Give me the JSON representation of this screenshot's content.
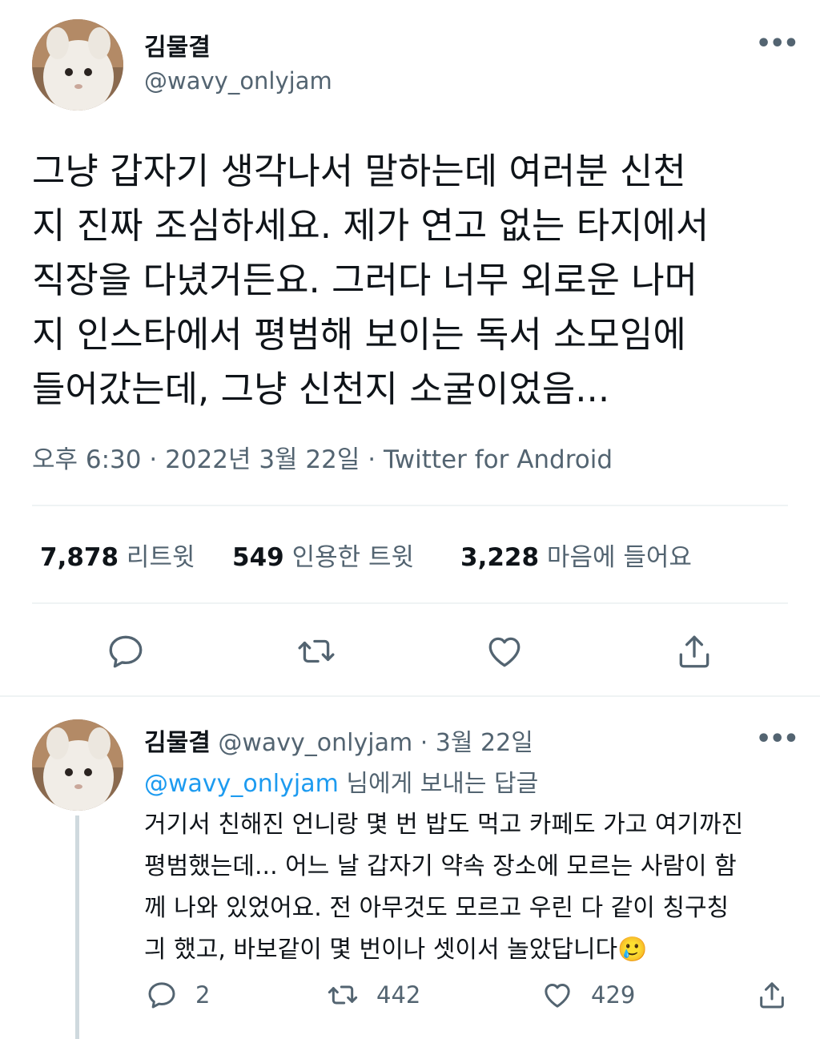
{
  "tweet": {
    "author_name": "김물결",
    "author_handle": "@wavy_onlyjam",
    "text": "그냥 갑자기 생각나서 말하는데 여러분 신천\n지 진짜 조심하세요. 제가 연고 없는 타지에서\n직장을 다녔거든요. 그러다 너무 외로운 나머\n지 인스타에서 평범해 보이는 독서 소모임에\n들어갔는데, 그냥 신천지 소굴이었음...",
    "meta": "오후 6:30 · 2022년 3월 22일 · Twitter for Android",
    "stats": [
      {
        "count": "7,878",
        "label": "리트윗"
      },
      {
        "count": "549",
        "label": "인용한 트윗"
      },
      {
        "count": "3,228",
        "label": "마음에 들어요"
      }
    ],
    "actions": [
      "reply-icon",
      "retweet-icon",
      "like-icon",
      "share-icon"
    ]
  },
  "reply": {
    "author_name": "김물결",
    "author_handle": "@wavy_onlyjam",
    "date": "· 3월 22일",
    "replying_mention": "@wavy_onlyjam",
    "replying_rest": " 님에게 보내는 답글",
    "text": "거기서 친해진 언니랑 몇 번 밥도 먹고 카페도 가고 여기까진\n평범했는데... 어느 날 갑자기 약속 장소에 모르는 사람이 함\n께 나와 있었어요. 전 아무것도 모르고 우린 다 같이 칭구칭\n긔 했고, 바보같이 몇 번이나 셋이서 놀았답니다",
    "emoji": "🥲",
    "reply_count": "2",
    "retweet_count": "442",
    "like_count": "429"
  },
  "more_glyph": "•••",
  "colors": {
    "text": "#0f1419",
    "secondary": "#536471",
    "link": "#1d9bf0",
    "divider": "#eff3f4"
  }
}
